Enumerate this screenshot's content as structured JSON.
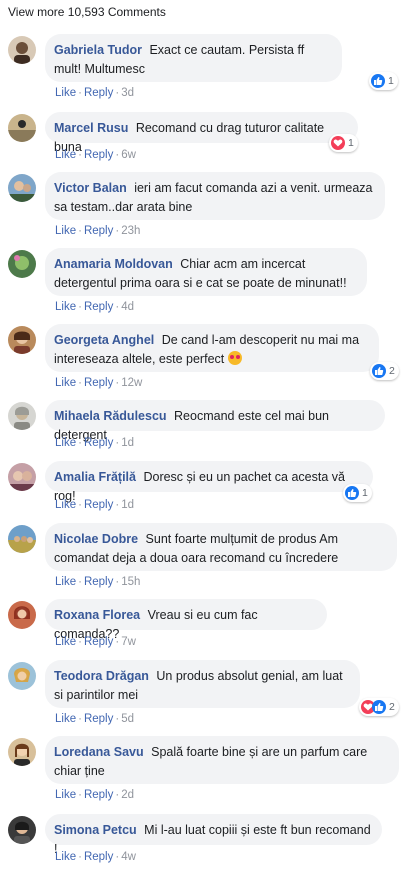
{
  "view_more": "View more 10,593 Comments",
  "actions": {
    "like": "Like",
    "reply": "Reply",
    "sep": "·"
  },
  "colors": {
    "link": "#385898",
    "bubble": "#f2f3f5",
    "like": "#1877f2",
    "love": "#f33e58"
  },
  "comments": [
    {
      "author": "Gabriela Tudor",
      "text": "Exact ce cautam. Persista ff mult! Multumesc",
      "time": "3d",
      "reactions": {
        "icons": [
          "like-icon"
        ],
        "count": "1"
      }
    },
    {
      "author": "Marcel Rusu",
      "text": "Recomand cu drag tuturor calitate buna",
      "time": "6w",
      "reactions": {
        "icons": [
          "love-icon"
        ],
        "count": "1"
      }
    },
    {
      "author": "Victor Balan",
      "text": "ieri am facut comanda azi a venit. urmeaza sa testam..dar arata bine",
      "time": "23h"
    },
    {
      "author": "Anamaria Moldovan",
      "text": "Chiar acm am incercat detergentul prima oara si e cat se poate de minunat!!",
      "time": "4d"
    },
    {
      "author": "Georgeta Anghel",
      "text": "De cand l-am descoperit nu mai ma intereseaza altele, este perfect",
      "emoji": "heart-eyes-emoji",
      "time": "12w",
      "reactions": {
        "icons": [
          "like-icon"
        ],
        "count": "2"
      }
    },
    {
      "author": "Mihaela Rădulescu",
      "text": "Reocmand este cel mai bun detergent",
      "time": "1d"
    },
    {
      "author": "Amalia Frățilă",
      "text": "Doresc și eu un pachet ca acesta vă rog!",
      "time": "1d",
      "reactions": {
        "icons": [
          "like-icon"
        ],
        "count": "1"
      }
    },
    {
      "author": "Nicolae Dobre",
      "text": "Sunt foarte mulțumit de produs Am comandat deja a doua oara recomand cu încredere",
      "time": "15h"
    },
    {
      "author": "Roxana Florea",
      "text": "Vreau si eu cum fac comanda??",
      "time": "7w"
    },
    {
      "author": "Teodora Drăgan",
      "text": "Un produs absolut genial, am luat si parintilor mei",
      "time": "5d",
      "reactions": {
        "icons": [
          "love-icon",
          "like-icon"
        ],
        "count": "2"
      }
    },
    {
      "author": "Loredana Savu",
      "text": "Spală foarte bine și are un parfum care chiar ține",
      "time": "2d"
    },
    {
      "author": "Simona Petcu",
      "text": "Mi l-au luat copiii și este ft bun recomand !",
      "time": "4w"
    }
  ]
}
